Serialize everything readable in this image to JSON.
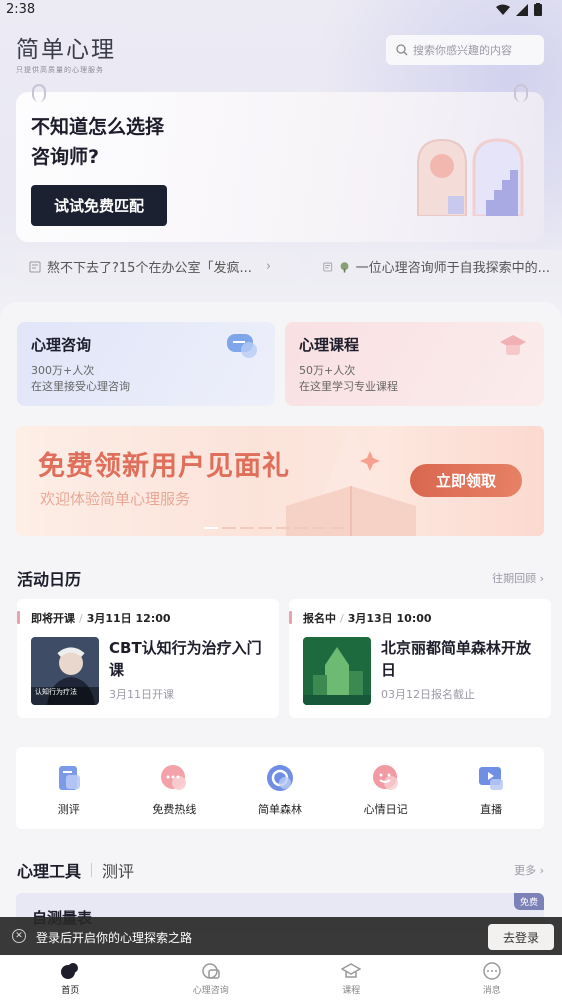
{
  "status": {
    "time": "2:38"
  },
  "header": {
    "logo": "简单心理",
    "slogan": "只提供高质量的心理服务",
    "search_placeholder": "搜索你感兴趣的内容"
  },
  "hero": {
    "question_line1": "不知道怎么选择",
    "question_line2": "咨询师?",
    "button": "试试免费匹配"
  },
  "ticker": [
    {
      "text": "熬不下去了?15个在办公室「发疯..."
    },
    {
      "text": "一位心理咨询师于自我探索中的..."
    }
  ],
  "services": [
    {
      "title": "心理咨询",
      "count": "300万+人次",
      "desc": "在这里接受心理咨询"
    },
    {
      "title": "心理课程",
      "count": "50万+人次",
      "desc": "在这里学习专业课程"
    }
  ],
  "banner": {
    "headline": "免费领新用户见面礼",
    "subline": "欢迎体验简单心理服务",
    "button": "立即领取"
  },
  "activities": {
    "title": "活动日历",
    "more": "往期回顾",
    "items": [
      {
        "status": "即将开课",
        "date": "3月11日 12:00",
        "title": "CBT认知行为治疗入门课",
        "note": "3月11日开课",
        "img_caption": "认知行为疗法"
      },
      {
        "status": "报名中",
        "date": "3月13日 10:00",
        "title": "北京丽都简单森林开放日",
        "note": "03月12日报名截止"
      }
    ]
  },
  "quick": [
    {
      "label": "测评",
      "icon": "clipboard-icon"
    },
    {
      "label": "免费热线",
      "icon": "chat-bubble-icon"
    },
    {
      "label": "简单森林",
      "icon": "forest-icon"
    },
    {
      "label": "心情日记",
      "icon": "smile-icon"
    },
    {
      "label": "直播",
      "icon": "live-icon"
    }
  ],
  "tools": {
    "title": "心理工具",
    "tab2": "测评",
    "more": "更多",
    "card_title": "自测量表",
    "badge": "免费"
  },
  "login": {
    "text": "登录后开启你的心理探索之路",
    "button": "去登录"
  },
  "nav": [
    {
      "label": "首页",
      "icon": "home-icon",
      "active": true
    },
    {
      "label": "心理咨询",
      "icon": "consult-icon"
    },
    {
      "label": "课程",
      "icon": "course-icon"
    },
    {
      "label": "消息",
      "icon": "message-icon"
    }
  ],
  "colors": {
    "dark_button": "#1c2131",
    "accent": "#df6e5a",
    "consult_card": "#e4e7f7",
    "course_card": "#f8e4e6"
  }
}
